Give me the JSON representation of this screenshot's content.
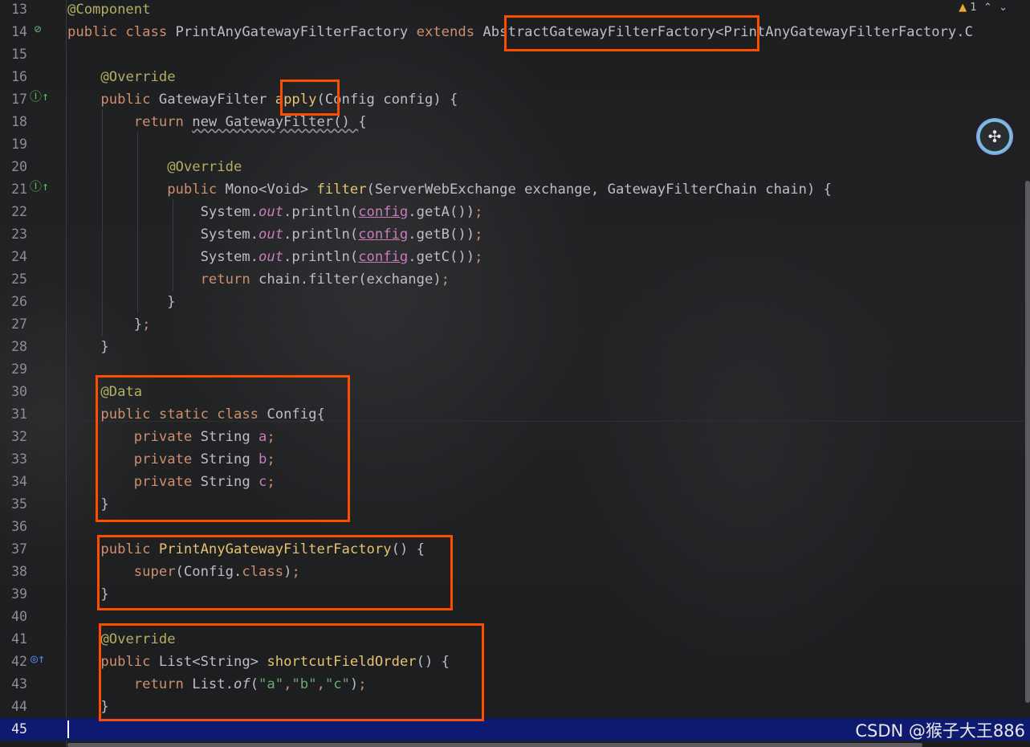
{
  "editor": {
    "warnings": {
      "icon": "warning-icon",
      "count": "1",
      "up": "^",
      "down": "v"
    },
    "plugin_icon": "ai-assistant-icon",
    "watermark": "CSDN @猴子大王886",
    "lines": [
      {
        "n": "13",
        "tokens": [
          [
            "@Component",
            "ann"
          ]
        ]
      },
      {
        "n": "14",
        "tokens": [
          [
            "public class ",
            "kw"
          ],
          [
            "PrintAnyGatewayFilterFactory ",
            ""
          ],
          [
            "extends ",
            "kw"
          ],
          [
            "AbstractGatewayFilterFactory",
            ""
          ],
          [
            "<PrintAnyGatewayFilterFactory.C",
            ""
          ]
        ]
      },
      {
        "n": "15",
        "tokens": []
      },
      {
        "n": "16",
        "tokens": [
          [
            "    ",
            ""
          ],
          [
            "@Override",
            "ann"
          ]
        ]
      },
      {
        "n": "17",
        "tokens": [
          [
            "    ",
            ""
          ],
          [
            "public ",
            "kw"
          ],
          [
            "GatewayFilter ",
            ""
          ],
          [
            "apply",
            "decl"
          ],
          [
            "(Config config) {",
            ""
          ]
        ]
      },
      {
        "n": "18",
        "tokens": [
          [
            "        ",
            ""
          ],
          [
            "return ",
            "kw"
          ],
          [
            "new GatewayFilter() ",
            "wavy"
          ],
          [
            "{",
            ""
          ]
        ]
      },
      {
        "n": "19",
        "tokens": []
      },
      {
        "n": "20",
        "tokens": [
          [
            "            ",
            ""
          ],
          [
            "@Override",
            "ann"
          ]
        ]
      },
      {
        "n": "21",
        "tokens": [
          [
            "            ",
            ""
          ],
          [
            "public ",
            "kw"
          ],
          [
            "Mono<Void> ",
            ""
          ],
          [
            "filter",
            "decl"
          ],
          [
            "(ServerWebExchange exchange, GatewayFilterChain chain) {",
            ""
          ]
        ]
      },
      {
        "n": "22",
        "tokens": [
          [
            "                System.",
            ""
          ],
          [
            "out",
            "ital"
          ],
          [
            ".println(",
            ""
          ],
          [
            "config",
            "link"
          ],
          [
            ".getA())",
            ""
          ],
          [
            ";",
            "kw"
          ]
        ]
      },
      {
        "n": "23",
        "tokens": [
          [
            "                System.",
            ""
          ],
          [
            "out",
            "ital"
          ],
          [
            ".println(",
            ""
          ],
          [
            "config",
            "link"
          ],
          [
            ".getB())",
            ""
          ],
          [
            ";",
            "kw"
          ]
        ]
      },
      {
        "n": "24",
        "tokens": [
          [
            "                System.",
            ""
          ],
          [
            "out",
            "ital"
          ],
          [
            ".println(",
            ""
          ],
          [
            "config",
            "link"
          ],
          [
            ".getC())",
            ""
          ],
          [
            ";",
            "kw"
          ]
        ]
      },
      {
        "n": "25",
        "tokens": [
          [
            "                ",
            ""
          ],
          [
            "return ",
            "kw"
          ],
          [
            "chain.filter(exchange)",
            ""
          ],
          [
            ";",
            "kw"
          ]
        ]
      },
      {
        "n": "26",
        "tokens": [
          [
            "            }",
            ""
          ]
        ]
      },
      {
        "n": "27",
        "tokens": [
          [
            "        }",
            ""
          ],
          [
            ";",
            "kw"
          ]
        ]
      },
      {
        "n": "28",
        "tokens": [
          [
            "    }",
            ""
          ]
        ]
      },
      {
        "n": "29",
        "tokens": []
      },
      {
        "n": "30",
        "tokens": [
          [
            "    ",
            ""
          ],
          [
            "@Data",
            "ann"
          ]
        ]
      },
      {
        "n": "31",
        "tokens": [
          [
            "    ",
            ""
          ],
          [
            "public static class ",
            "kw"
          ],
          [
            "Config{",
            ""
          ]
        ]
      },
      {
        "n": "32",
        "tokens": [
          [
            "        ",
            ""
          ],
          [
            "private ",
            "kw"
          ],
          [
            "String ",
            ""
          ],
          [
            "a",
            "fld"
          ],
          [
            ";",
            "kw"
          ]
        ]
      },
      {
        "n": "33",
        "tokens": [
          [
            "        ",
            ""
          ],
          [
            "private ",
            "kw"
          ],
          [
            "String ",
            ""
          ],
          [
            "b",
            "fld"
          ],
          [
            ";",
            "kw"
          ]
        ]
      },
      {
        "n": "34",
        "tokens": [
          [
            "        ",
            ""
          ],
          [
            "private ",
            "kw"
          ],
          [
            "String ",
            ""
          ],
          [
            "c",
            "fld"
          ],
          [
            ";",
            "kw"
          ]
        ]
      },
      {
        "n": "35",
        "tokens": [
          [
            "    }",
            ""
          ]
        ]
      },
      {
        "n": "36",
        "tokens": []
      },
      {
        "n": "37",
        "tokens": [
          [
            "    ",
            ""
          ],
          [
            "public ",
            "kw"
          ],
          [
            "PrintAnyGatewayFilterFactory",
            "decl"
          ],
          [
            "() {",
            ""
          ]
        ]
      },
      {
        "n": "38",
        "tokens": [
          [
            "        ",
            ""
          ],
          [
            "super",
            "kw"
          ],
          [
            "(Config.",
            ""
          ],
          [
            "class",
            "kw"
          ],
          [
            ")",
            ""
          ],
          [
            ";",
            "kw"
          ]
        ]
      },
      {
        "n": "39",
        "tokens": [
          [
            "    }",
            ""
          ]
        ]
      },
      {
        "n": "40",
        "tokens": []
      },
      {
        "n": "41",
        "tokens": [
          [
            "    ",
            ""
          ],
          [
            "@Override",
            "ann"
          ]
        ]
      },
      {
        "n": "42",
        "tokens": [
          [
            "    ",
            ""
          ],
          [
            "public ",
            "kw"
          ],
          [
            "List<String> ",
            ""
          ],
          [
            "shortcutFieldOrder",
            "decl"
          ],
          [
            "() {",
            ""
          ]
        ]
      },
      {
        "n": "43",
        "tokens": [
          [
            "        ",
            ""
          ],
          [
            "return ",
            "kw"
          ],
          [
            "List.",
            ""
          ],
          [
            "of",
            "italfn"
          ],
          [
            "(",
            ""
          ],
          [
            "\"a\"",
            "str"
          ],
          [
            ",",
            "kw"
          ],
          [
            "\"b\"",
            "str"
          ],
          [
            ",",
            "kw"
          ],
          [
            "\"c\"",
            "str"
          ],
          [
            ")",
            ""
          ],
          [
            ";",
            "kw"
          ]
        ]
      },
      {
        "n": "44",
        "tokens": [
          [
            "    }",
            ""
          ]
        ]
      },
      {
        "n": "45",
        "tokens": [],
        "current": true
      }
    ],
    "gutter_icons": [
      {
        "line": "14",
        "icon": "bean-icon",
        "glyph": "⊘",
        "color": "#6aab73"
      },
      {
        "line": "17",
        "icon": "implements-method-icon",
        "glyph": "Ⓘ↑",
        "color": "#5fb865"
      },
      {
        "line": "21",
        "icon": "implements-method-icon",
        "glyph": "Ⓘ↑",
        "color": "#5fb865"
      },
      {
        "line": "42",
        "icon": "overrides-method-icon",
        "glyph": "◎↑",
        "color": "#548af7"
      }
    ]
  }
}
